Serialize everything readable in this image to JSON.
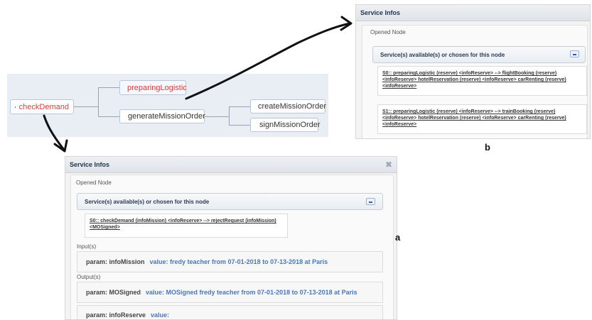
{
  "tree": {
    "root": "checkDemand",
    "child_preparing": "preparingLogistic",
    "child_generate": "generateMissionOrder",
    "leaf_create": "createMissionOrder",
    "leaf_sign": "signMissionOrder"
  },
  "panel_b": {
    "title": "Service Infos",
    "opened_node": "Opened Node",
    "services_header": "Service(s) available(s) or chosen for this node",
    "services": [
      "S0:: preparingLogistic (reserve) <infoReserve> --> flightBooking (reserve) <infoReserve> hotelReservation (reserve) <infoReserve> carRenting (reserve) <infoReserve>",
      "S1:: preparingLogistic (reserve) <infoReserve> --> trainBooking (reserve) <infoReserve> hotelReservation (reserve) <infoReserve> carRenting (reserve) <infoReserve>"
    ]
  },
  "panel_a": {
    "title": "Service Infos",
    "opened_node": "Opened Node",
    "services_header": "Service(s) available(s) or chosen for this node",
    "service": "S0:: checkDemand (infoMission) <infoReserve> --> rejectRequest (infoMission) <MOSigned>",
    "input_label": "Input(s)",
    "output_label": "Output(s)",
    "inputs": [
      {
        "param": "param: infoMission",
        "value": "value: fredy teacher from 07-01-2018 to 07-13-2018 at Paris"
      }
    ],
    "outputs": [
      {
        "param": "param: MOSigned",
        "value": "value: MOSigned fredy teacher from 07-01-2018 to 07-13-2018 at Paris"
      },
      {
        "param": "param: infoReserve",
        "value": "value:"
      }
    ]
  },
  "labels": {
    "a": "a",
    "b": "b"
  },
  "colors": {
    "arrow": "#111111",
    "link_red": "#e03b3b",
    "value_blue": "#4a78b8"
  }
}
